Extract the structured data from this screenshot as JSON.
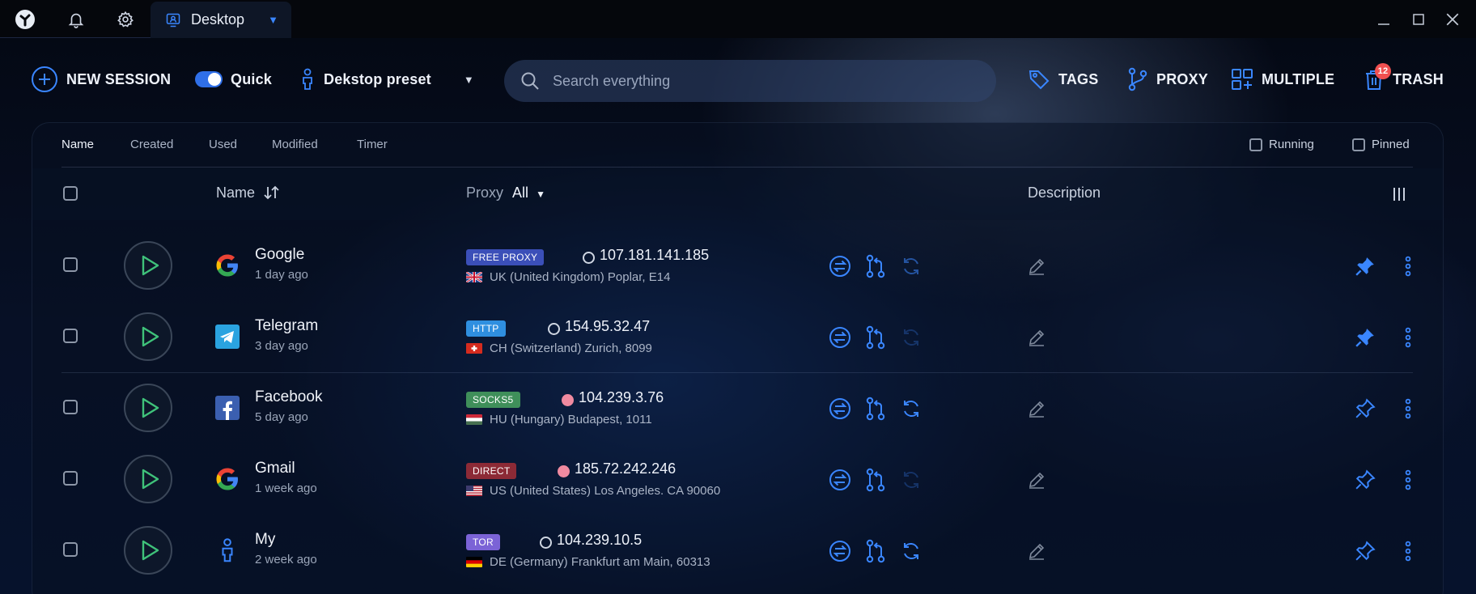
{
  "titlebar": {
    "tab_label": "Desktop"
  },
  "toolbar": {
    "new_session": "NEW SESSION",
    "quick": "Quick",
    "preset": "Dekstop preset",
    "search_placeholder": "Search everything",
    "tags": "TAGS",
    "proxy": "PROXY",
    "multiple": "MULTIPLE",
    "trash": "TRASH",
    "trash_count": "12"
  },
  "sort_tabs": [
    "Name",
    "Created",
    "Used",
    "Modified",
    "Timer"
  ],
  "filters": {
    "running": "Running",
    "pinned": "Pinned"
  },
  "table": {
    "col_name": "Name",
    "col_proxy": "Proxy",
    "col_proxy_filter": "All",
    "col_description": "Description"
  },
  "sessions": [
    {
      "name": "Google",
      "time": "1 day ago",
      "tag": "FREE PROXY",
      "tag_color": "#3b4fb8",
      "dot": "ring",
      "ip": "107.181.141.185",
      "flag": "uk",
      "location": "UK (United Kingdom) Poplar, E14",
      "pinned": true,
      "sync": "dim"
    },
    {
      "name": "Telegram",
      "time": "3 day ago",
      "tag": "HTTP",
      "tag_color": "#2f8fe0",
      "dot": "ring",
      "ip": "154.95.32.47",
      "flag": "ch",
      "location": "CH (Switzerland) Zurich, 8099",
      "pinned": true,
      "sync": "faint"
    },
    {
      "name": "Facebook",
      "time": "5 day ago",
      "tag": "SOCKS5",
      "tag_color": "#3f8f5a",
      "dot": "fill",
      "ip": "104.239.3.76",
      "flag": "hu",
      "location": "HU (Hungary) Budapest, 1011",
      "pinned": false,
      "sync": "on"
    },
    {
      "name": "Gmail",
      "time": "1 week ago",
      "tag": "DIRECT",
      "tag_color": "#8c2a36",
      "dot": "fill",
      "ip": "185.72.242.246",
      "flag": "us",
      "location": "US (United States) Los Angeles. CA 90060",
      "pinned": false,
      "sync": "faint"
    },
    {
      "name": "My",
      "time": "2 week ago",
      "tag": "TOR",
      "tag_color": "#7b63d6",
      "dot": "ring",
      "ip": "104.239.10.5",
      "flag": "de",
      "location": "DE (Germany) Frankfurt am Main, 60313",
      "pinned": false,
      "sync": "on"
    }
  ]
}
